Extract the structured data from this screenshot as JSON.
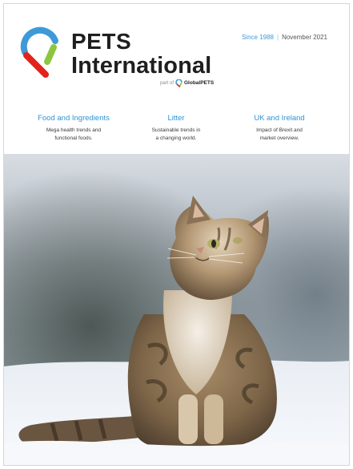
{
  "brand": {
    "name_line1": "PETS",
    "name_line2": "International",
    "part_of": "part of",
    "parent_brand": "GlobalPETS",
    "colors": {
      "blue": "#3e9ad6",
      "green": "#8cc63f",
      "red": "#e2231a",
      "text": "#1f1f1f"
    }
  },
  "issue": {
    "since": "Since 1988",
    "month": "November 2021"
  },
  "teasers": [
    {
      "title": "Food and Ingredients",
      "line1": "Mega health trends and",
      "line2": "functional foods."
    },
    {
      "title": "Litter",
      "line1": "Sustainable trends in",
      "line2": "a changing world."
    },
    {
      "title": "UK and Ireland",
      "line1": "Impact of Brexit and",
      "line2": "market overview."
    }
  ],
  "cover_image": {
    "subject": "long-haired tabby cat sitting in snow looking up"
  }
}
